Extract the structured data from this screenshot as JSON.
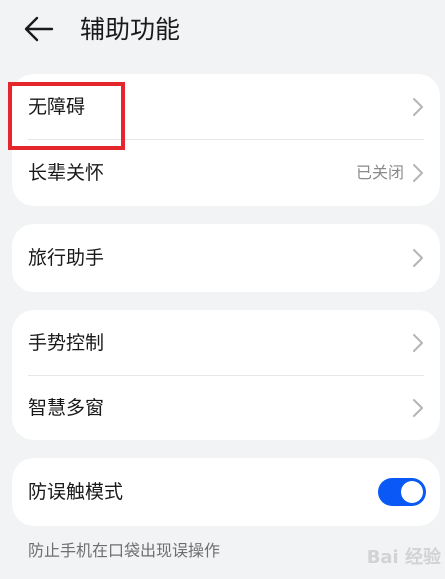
{
  "header": {
    "title": "辅助功能",
    "back_icon": "arrow-left-icon"
  },
  "groups": [
    {
      "items": [
        {
          "label": "无障碍",
          "value": ""
        },
        {
          "label": "长辈关怀",
          "value": "已关闭"
        }
      ]
    },
    {
      "items": [
        {
          "label": "旅行助手",
          "value": ""
        }
      ]
    },
    {
      "items": [
        {
          "label": "手势控制",
          "value": ""
        },
        {
          "label": "智慧多窗",
          "value": ""
        }
      ]
    },
    {
      "items": [
        {
          "label": "防误触模式",
          "toggle": "on"
        }
      ]
    }
  ],
  "hint_text": "防止手机在口袋出现误操作",
  "watermark": "Bai 经验",
  "colors": {
    "background": "#f1f3f5",
    "card": "#ffffff",
    "accent": "#0a59f7",
    "highlight": "#e5262c"
  }
}
